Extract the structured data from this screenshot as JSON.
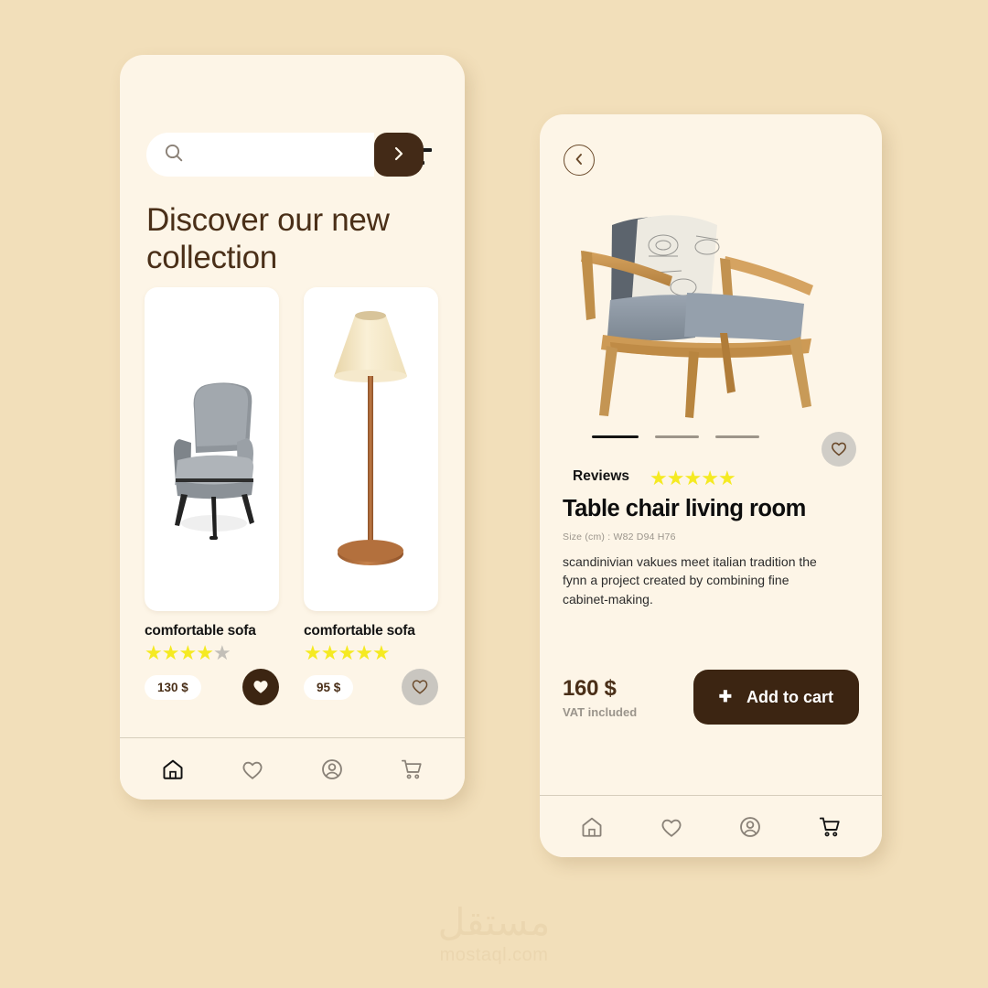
{
  "theme": {
    "page_background": "#F2DFBA",
    "phone_background": "#FDF5E7",
    "brand_dark": "#3C2512",
    "accent_brown": "#4A2F18",
    "star_yellow": "#F5EA22",
    "muted_grey": "#9A948B"
  },
  "home": {
    "menu_icon": "hamburger-icon",
    "search": {
      "placeholder": "",
      "value": "",
      "icon": "search-icon",
      "submit_icon": "chevron-right-icon"
    },
    "headline": "Discover our new collection",
    "products": [
      {
        "image": "grey-armchair",
        "title": "comfortable sofa",
        "rating": 4,
        "rating_max": 5,
        "price": "130 $",
        "favorited": true
      },
      {
        "image": "floor-lamp",
        "title": "comfortable sofa",
        "rating": 5,
        "rating_max": 5,
        "price": "95 $",
        "favorited": false
      }
    ],
    "nav": [
      {
        "icon": "home-icon",
        "active": true
      },
      {
        "icon": "heart-icon",
        "active": false
      },
      {
        "icon": "profile-icon",
        "active": false
      },
      {
        "icon": "cart-icon",
        "active": false
      }
    ]
  },
  "detail": {
    "back_icon": "chevron-left-icon",
    "hero_image": "wooden-armchair-with-pillow",
    "carousel": {
      "total": 3,
      "active_index": 0
    },
    "favorite_icon": "heart-icon",
    "reviews_label": "Reviews",
    "rating": 5,
    "rating_max": 5,
    "title": "Table chair living room",
    "size": "Size (cm) : W82   D94    H76",
    "description": "scandinivian vakues meet italian tradition the fynn a project created by combining fine cabinet-making.",
    "price": "160 $",
    "price_note": "VAT included",
    "cart_button": {
      "label": "Add to cart",
      "icon": "plus-icon"
    },
    "nav": [
      {
        "icon": "home-icon",
        "active": false
      },
      {
        "icon": "heart-icon",
        "active": false
      },
      {
        "icon": "profile-icon",
        "active": false
      },
      {
        "icon": "cart-icon",
        "active": true
      }
    ]
  },
  "watermark": {
    "arabic": "مستقل",
    "latin": "mostaql.com"
  }
}
